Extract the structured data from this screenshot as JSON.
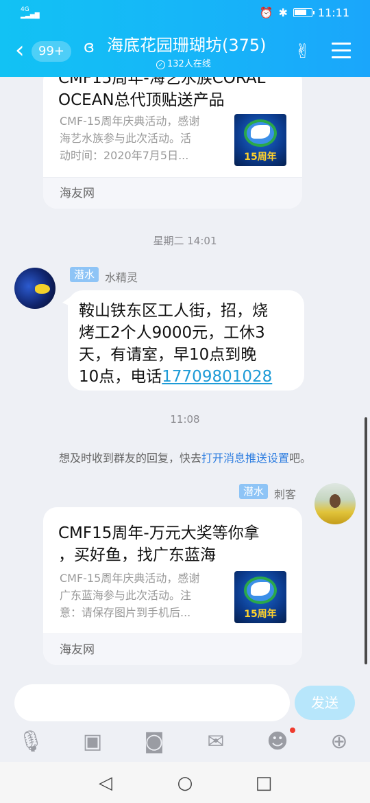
{
  "status_bar": {
    "network": "4G",
    "time": "11:11"
  },
  "header": {
    "unread_badge": "99+",
    "title": "海底花园珊瑚坊(375)",
    "online": "132人在线"
  },
  "card1": {
    "title_line1": "CMF15周年-海艺水族CORAL",
    "title_line2": "OCEAN总代顶贴送产品",
    "desc_line1": "CMF-15周年庆典活动，感谢",
    "desc_line2": "海艺水族参与此次活动。活",
    "desc_line3": "动时间：2020年7月5日...",
    "thumb_label": "15周年",
    "source": "海友网"
  },
  "time1": "星期二 14:01",
  "msg1": {
    "tag": "潜水",
    "nick": "水精灵",
    "line1": "鞍山铁东区工人街，招，烧",
    "line2": "烤工2个人9000元，工休3",
    "line3": "天，有请室，早10点到晚",
    "line4_prefix": "10点，电话",
    "phone": "17709801028"
  },
  "time2": "11:08",
  "notice": {
    "prefix": "想及时收到群友的回复，快去",
    "link": "打开消息推送设置",
    "suffix": "吧。"
  },
  "msg2": {
    "tag": "潜水",
    "nick": "刺客",
    "title_line1": "CMF15周年-万元大奖等你拿",
    "title_line2": "，买好鱼，找广东蓝海",
    "desc_line1": "CMF-15周年庆典活动，感谢",
    "desc_line2": "广东蓝海参与此次活动。注",
    "desc_line3": "意：请保存图片到手机后...",
    "thumb_label": "15周年",
    "source": "海友网"
  },
  "input": {
    "placeholder": "",
    "send_label": "发送"
  },
  "icons": {
    "back": "back-chevron-icon",
    "ear": "ear-icon",
    "hand": "hand-gesture-icon",
    "menu": "menu-icon",
    "mic": "microphone-icon",
    "image": "image-icon",
    "camera": "camera-icon",
    "redpacket": "red-packet-icon",
    "emoji": "emoji-icon",
    "plus": "plus-icon"
  },
  "colors": {
    "header": "#16b6f8",
    "link": "#1e9bd7",
    "tag": "#8ec4f6",
    "send": "#b7e6fb"
  }
}
